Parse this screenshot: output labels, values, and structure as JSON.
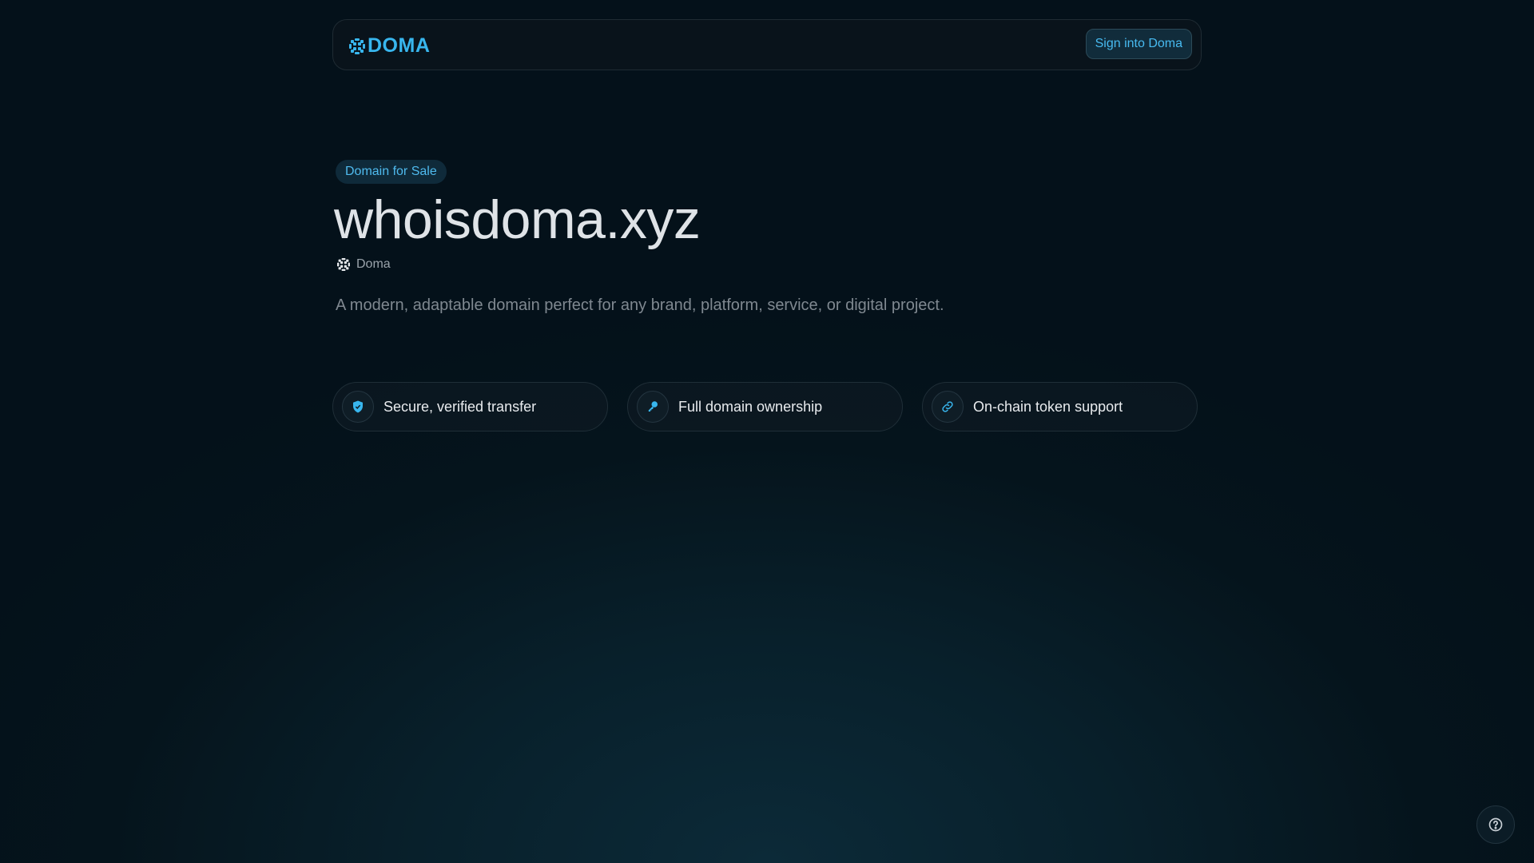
{
  "header": {
    "logo_text": "DOMA",
    "signin_label": "Sign into Doma"
  },
  "hero": {
    "badge": "Domain for Sale",
    "domain": "whoisdoma.xyz",
    "owner": "Doma",
    "description": "A modern, adaptable domain perfect for any brand, platform, service, or digital project."
  },
  "features": [
    {
      "icon": "shield-check-icon",
      "label": "Secure, verified transfer"
    },
    {
      "icon": "key-icon",
      "label": "Full domain ownership"
    },
    {
      "icon": "link-icon",
      "label": "On-chain token support"
    }
  ],
  "colors": {
    "accent": "#38b6ee",
    "background": "#05141c"
  }
}
